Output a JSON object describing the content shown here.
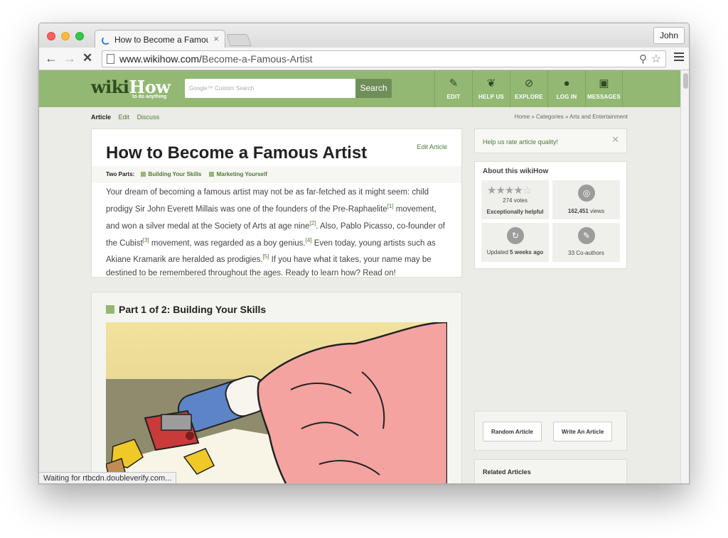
{
  "browser": {
    "tab_title": "How to Become a Famous Artist",
    "tab_close": "×",
    "profile": "John",
    "url_domain": "www.wikihow.com/",
    "url_path": "Become-a-Famous-Artist",
    "status": "Waiting for rtbcdn.doubleverify.com..."
  },
  "header": {
    "logo_wiki": "wiki",
    "logo_how": "How",
    "logo_tagline": "to do anything",
    "search_placeholder": "Google™ Custom Search",
    "search_button": "Search",
    "nav": [
      {
        "label": "EDIT",
        "icon": "✎"
      },
      {
        "label": "HELP US",
        "icon": "❦"
      },
      {
        "label": "EXPLORE",
        "icon": "⊘"
      },
      {
        "label": "LOG IN",
        "icon": "●"
      },
      {
        "label": "MESSAGES",
        "icon": "▣"
      }
    ]
  },
  "subnav": {
    "tabs": [
      "Article",
      "Edit",
      "Discuss"
    ],
    "breadcrumb": "Home » Categories » Arts and Entertainment"
  },
  "article": {
    "title": "How to Become a Famous Artist",
    "edit_link": "Edit Article",
    "two_parts_label": "Two Parts:",
    "parts": [
      "Building Your Skills",
      "Marketing Yourself"
    ],
    "intro_segments": [
      "Your dream of becoming a famous artist may not be as far-fetched as it might seem: child prodigy Sir John Everett Millais was one of the founders of the Pre-Raphaelite",
      "[1]",
      " movement, and won a silver medal at the Society of Arts at age nine",
      "[2]",
      ". Also, Pablo Picasso, co-founder of the Cubist",
      "[3]",
      " movement, was regarded as a boy genius.",
      "[4]",
      " Even today, young artists such as Akiane Kramarik are heralded as prodigies.",
      "[5]",
      " If you have what it takes, your name may be destined to be remembered throughout the ages. Ready to learn how? Read on!"
    ],
    "part1_heading": "Part 1 of 2: Building Your Skills"
  },
  "sidebar": {
    "rate_text": "Help us rate article quality!",
    "rate_close": "✕",
    "about_title": "About this wikiHow",
    "rating_stars_filled": 4,
    "rating_stars_total": 5,
    "votes": "274 votes",
    "helpful": "Exceptionally helpful",
    "views_number": "162,451",
    "views_label": "views",
    "updated_prefix": "Updated",
    "updated_value": "5 weeks ago",
    "coauthors": "33 Co-authors",
    "random_button": "Random Article",
    "write_button": "Write An Article",
    "related_title": "Related Articles"
  },
  "colors": {
    "brand_green": "#93b874",
    "link_green": "#4f7a35",
    "page_bg": "#ebebe7"
  }
}
